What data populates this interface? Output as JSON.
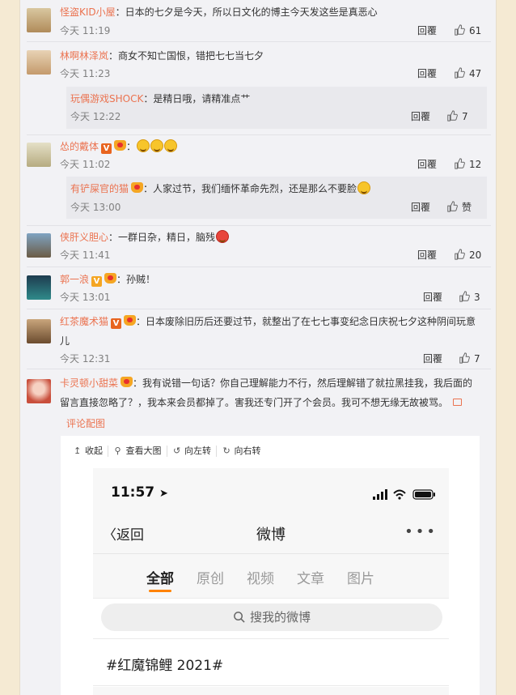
{
  "comments": [
    {
      "user": "怪盗KID小屋",
      "text": "：日本的七夕是今天，所以日文化的博主今天发这些是真恶心",
      "time": "今天 11:19",
      "reply": "回覆",
      "likes": "61"
    },
    {
      "user": "林啊林泽岚",
      "text": "：商女不知亡国恨，错把七七当七夕",
      "time": "今天 11:23",
      "reply": "回覆",
      "likes": "47",
      "sub": {
        "user": "玩偶游戏SHOCK",
        "text": "：是精日哦，请精准点艹",
        "time": "今天 12:22",
        "reply": "回覆",
        "likes": "7"
      }
    },
    {
      "user": "怂的戴体",
      "text": "：",
      "time": "今天 11:02",
      "reply": "回覆",
      "likes": "12",
      "sub": {
        "user": "有铲屎官的猫",
        "text": "：人家过节，我们缅怀革命先烈，还是那么不要脸",
        "time": "今天 13:00",
        "reply": "回覆",
        "likes": "赞"
      }
    },
    {
      "user": "侠肝义胆心",
      "text": "：一群日杂，精日，脑残",
      "time": "今天 11:41",
      "reply": "回覆",
      "likes": "20"
    },
    {
      "user": "郭一浪",
      "text": "：孙贼！",
      "time": "今天 13:01",
      "reply": "回覆",
      "likes": "3"
    },
    {
      "user": "红茶魔术猫",
      "text": "：日本废除旧历后还要过节，就整出了在七七事变纪念日庆祝七夕这种阴间玩意",
      "text2": "儿",
      "time": "今天 12:31",
      "reply": "回覆",
      "likes": "7"
    },
    {
      "user": "卡灵顿小甜菜",
      "text": "：我有说错一句话？你自己理解能力不行，然后理解错了就拉黑挂我，我后面的",
      "text2": "留言直接忽略了？，我本来会员都掉了。害我还专门开了个会员。我可不想无缘无故被骂。",
      "review_pic": "评论配图"
    }
  ],
  "image_toolbar": {
    "collapse": "收起",
    "view_large": "查看大图",
    "rotate_left": "向左转",
    "rotate_right": "向右转"
  },
  "phone": {
    "clock": "11:57",
    "back": "返回",
    "title": "微博",
    "more": "•••",
    "tabs": [
      "全部",
      "原创",
      "视频",
      "文章",
      "图片"
    ],
    "search_placeholder": "搜我的微博",
    "hashtag": "#红魔锦鲤 2021#"
  },
  "colors": {
    "accent": "#eb7350",
    "tab_underline": "#ff8200",
    "background": "#f5ead3"
  }
}
